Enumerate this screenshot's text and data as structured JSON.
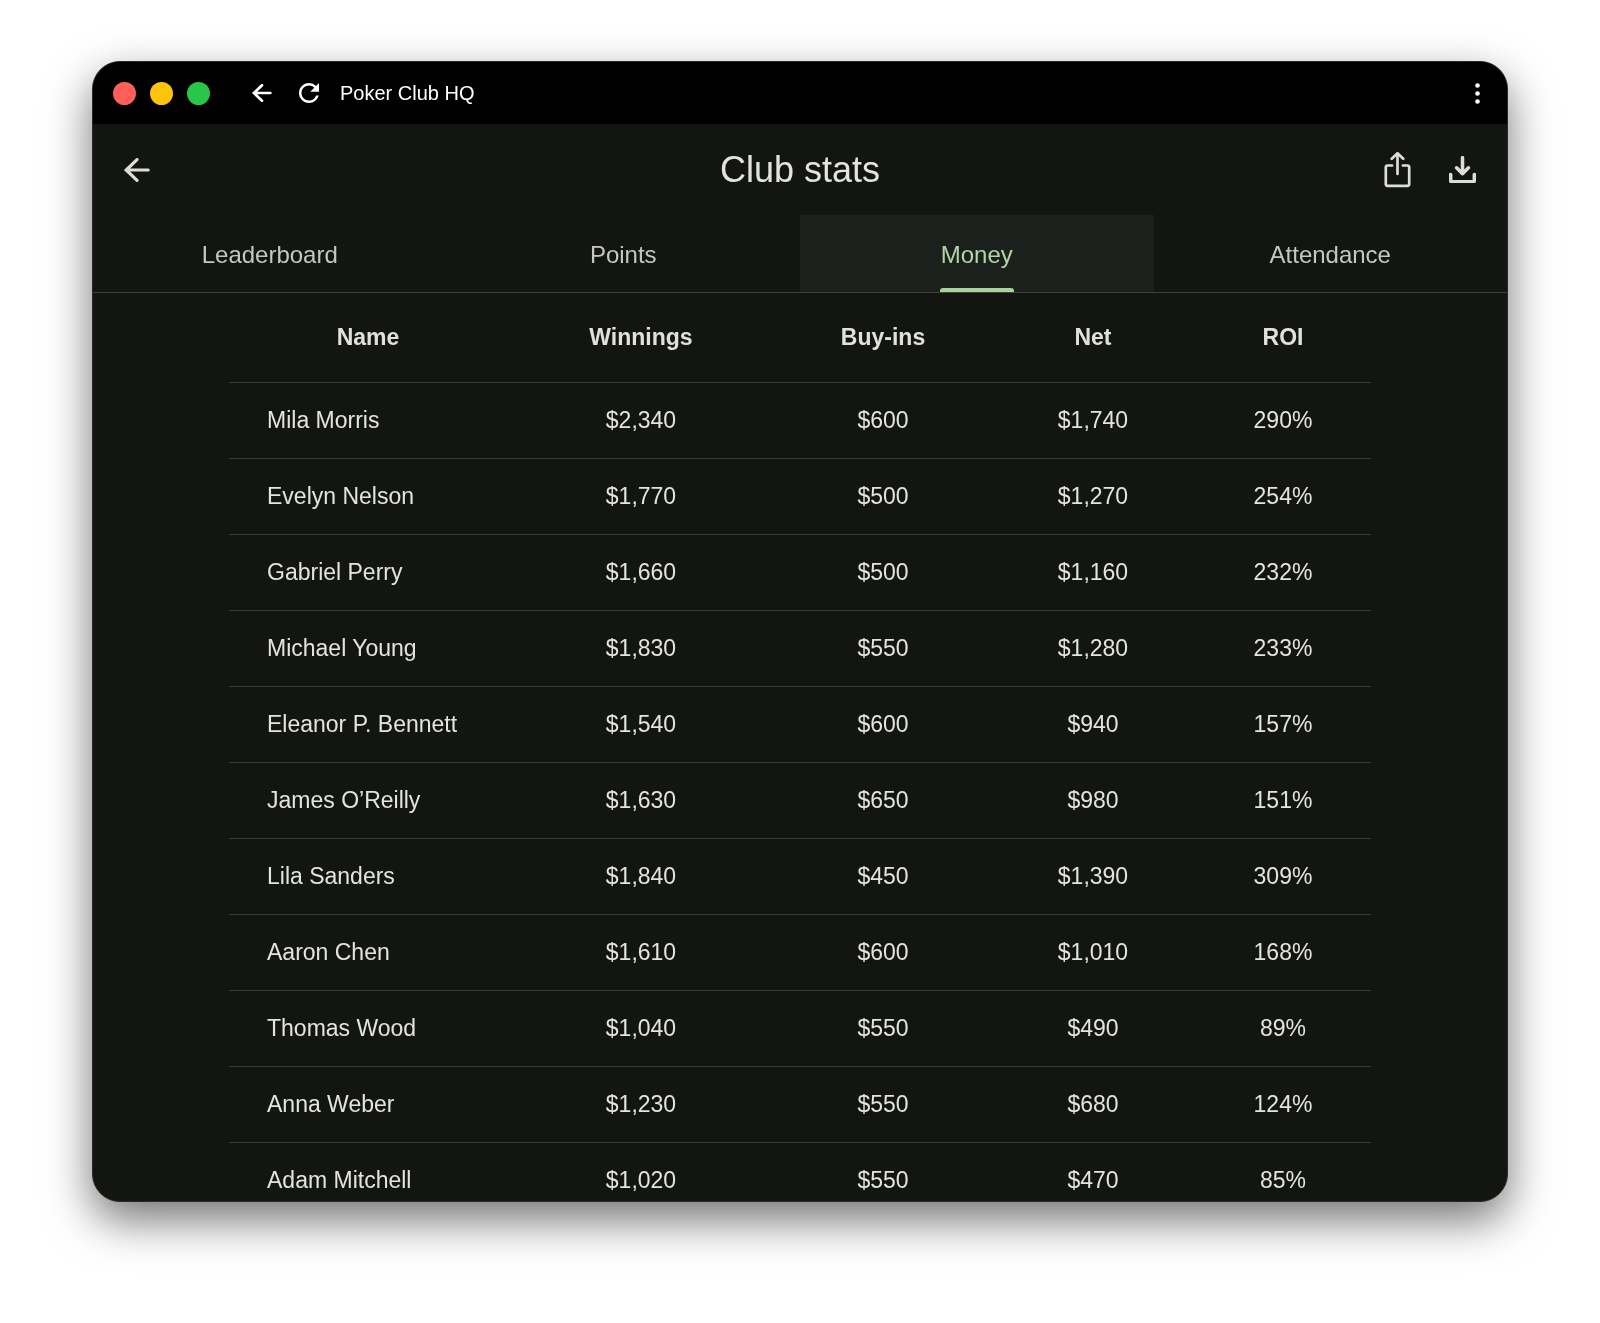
{
  "window": {
    "title": "Poker Club HQ"
  },
  "app_bar": {
    "title": "Club stats"
  },
  "tabs": [
    {
      "label": "Leaderboard",
      "selected": false
    },
    {
      "label": "Points",
      "selected": false
    },
    {
      "label": "Money",
      "selected": true
    },
    {
      "label": "Attendance",
      "selected": false
    }
  ],
  "table": {
    "columns": [
      "Name",
      "Winnings",
      "Buy-ins",
      "Net",
      "ROI"
    ],
    "rows": [
      [
        "Mila Morris",
        "$2,340",
        "$600",
        "$1,740",
        "290%"
      ],
      [
        "Evelyn Nelson",
        "$1,770",
        "$500",
        "$1,270",
        "254%"
      ],
      [
        "Gabriel Perry",
        "$1,660",
        "$500",
        "$1,160",
        "232%"
      ],
      [
        "Michael Young",
        "$1,830",
        "$550",
        "$1,280",
        "233%"
      ],
      [
        "Eleanor P. Bennett",
        "$1,540",
        "$600",
        "$940",
        "157%"
      ],
      [
        "James O’Reilly",
        "$1,630",
        "$650",
        "$980",
        "151%"
      ],
      [
        "Lila Sanders",
        "$1,840",
        "$450",
        "$1,390",
        "309%"
      ],
      [
        "Aaron Chen",
        "$1,610",
        "$600",
        "$1,010",
        "168%"
      ],
      [
        "Thomas Wood",
        "$1,040",
        "$550",
        "$490",
        "89%"
      ],
      [
        "Anna Weber",
        "$1,230",
        "$550",
        "$680",
        "124%"
      ],
      [
        "Adam Mitchell",
        "$1,020",
        "$550",
        "$470",
        "85%"
      ]
    ]
  }
}
